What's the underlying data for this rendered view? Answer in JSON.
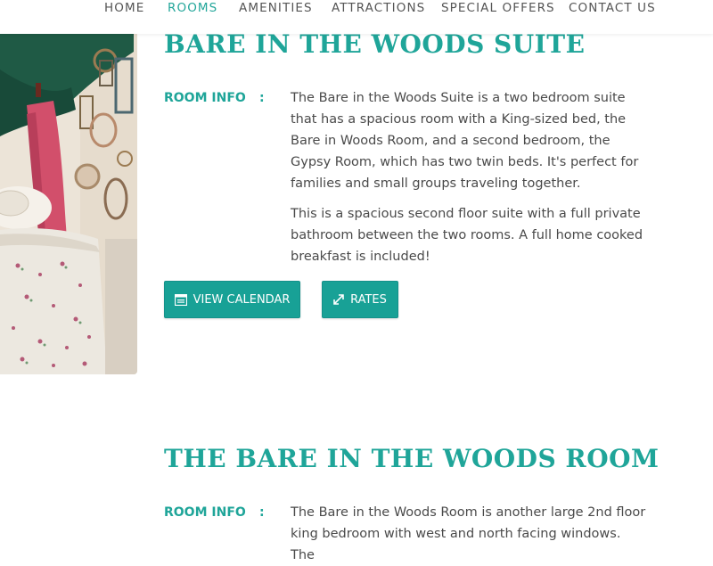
{
  "nav": {
    "items": [
      {
        "label": "HOME",
        "active": false
      },
      {
        "label": "ROOMS",
        "active": true
      },
      {
        "label": "AMENITIES",
        "active": false
      },
      {
        "label": "ATTRACTIONS",
        "active": false
      },
      {
        "label": "SPECIAL OFFERS",
        "active": false
      },
      {
        "label": "CONTACT US",
        "active": false
      }
    ]
  },
  "colors": {
    "accent": "#1fa599",
    "button": "#18a196",
    "nav_active": "#23a69a",
    "text": "#4a4a4a"
  },
  "rooms": [
    {
      "title": "BARE IN THE WOODS SUITE",
      "info_label": "ROOM INFO",
      "colon": ":",
      "paragraphs": [
        "The Bare in the Woods Suite is a two bedroom suite that has a spacious room with a King-sized bed, the Bare in Woods Room, and a second bedroom, the Gypsy Room, which has two twin beds. It's perfect for families and small groups traveling together.",
        "This is a spacious second floor suite with a full private bathroom between the two rooms. A full home cooked breakfast is included!"
      ],
      "buttons": {
        "calendar": {
          "label": "VIEW CALENDAR",
          "icon": "calendar-icon"
        },
        "rates": {
          "label": "RATES",
          "icon": "expand-icon"
        }
      }
    },
    {
      "title": "THE BARE IN THE WOODS ROOM",
      "info_label": "ROOM INFO",
      "colon": ":",
      "paragraphs": [
        "The Bare in the Woods Room is another large 2nd floor king bedroom with west and north facing windows. The"
      ]
    }
  ]
}
